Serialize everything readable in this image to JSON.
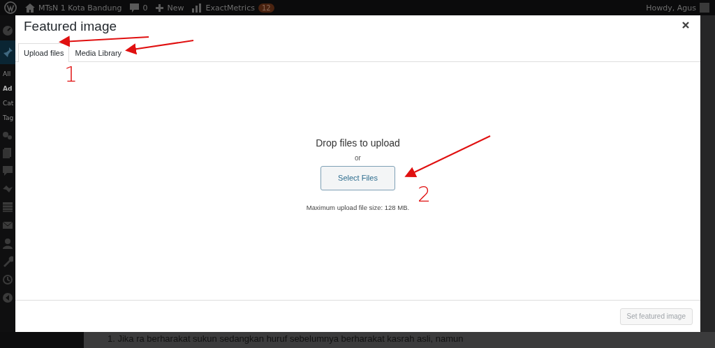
{
  "admin_bar": {
    "site": "MTsN 1 Kota Bandung",
    "comments": "0",
    "new": "New",
    "plugin": "ExactMetrics",
    "plugin_badge": "12",
    "greeting": "Howdy, Agus"
  },
  "sidebar": {
    "items": [
      {
        "kind": "dashboard",
        "selected": false
      },
      {
        "kind": "posts",
        "selected": true
      },
      {
        "kind": "text",
        "label": "All",
        "selected": false
      },
      {
        "kind": "text",
        "label": "Ad",
        "selected": true
      },
      {
        "kind": "text",
        "label": "Cat",
        "selected": false
      },
      {
        "kind": "text",
        "label": "Tag",
        "selected": false
      },
      {
        "kind": "media",
        "selected": false
      },
      {
        "kind": "pages",
        "selected": false
      },
      {
        "kind": "comments",
        "selected": false
      },
      {
        "kind": "links",
        "selected": false
      },
      {
        "kind": "forms",
        "selected": false
      },
      {
        "kind": "mail",
        "selected": false
      },
      {
        "kind": "users",
        "selected": false
      },
      {
        "kind": "tools",
        "selected": false
      },
      {
        "kind": "history",
        "selected": false
      },
      {
        "kind": "collapse",
        "selected": false
      }
    ]
  },
  "modal": {
    "title": "Featured image",
    "tabs": [
      {
        "label": "Upload files",
        "selected": true
      },
      {
        "label": "Media Library",
        "selected": false
      }
    ],
    "upload": {
      "heading": "Drop files to upload",
      "or": "or",
      "button": "Select Files",
      "limit": "Maximum upload file size: 128 MB."
    },
    "footer": {
      "button": "Set featured image",
      "disabled": true
    }
  },
  "background_text": "1. Jika ra berharakat sukun sedangkan huruf sebelumnya berharakat kasrah asli, namun",
  "annotations": {
    "marks": [
      "1",
      "2"
    ]
  }
}
